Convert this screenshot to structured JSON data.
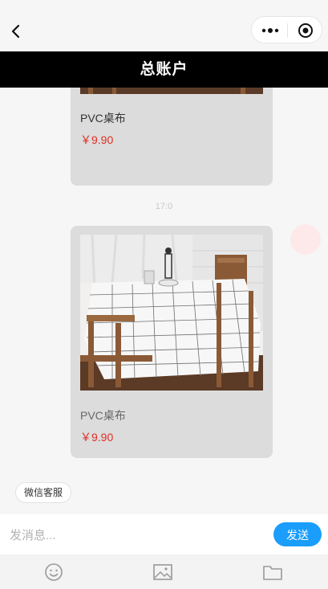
{
  "nav": {
    "back_icon": "chevron-left-icon",
    "more_icon": "more-dots-icon",
    "close_icon": "target-circle-icon"
  },
  "header": {
    "title": "总账户"
  },
  "messages": {
    "time_label": "17:0",
    "cards": [
      {
        "name": "PVC桌布",
        "price": "￥9.90"
      },
      {
        "name": "PVC桌布",
        "price": "￥9.90"
      }
    ]
  },
  "quick_reply": {
    "label": "微信客服"
  },
  "composer": {
    "placeholder": "发消息...",
    "send_label": "发送"
  },
  "toolbar": {
    "icons": [
      "emoji-icon",
      "image-icon",
      "folder-icon"
    ]
  },
  "colors": {
    "title_bar": "#000000",
    "send_button": "#1a9dfb",
    "price": "#e02e24",
    "card": "#dcdcdc"
  }
}
